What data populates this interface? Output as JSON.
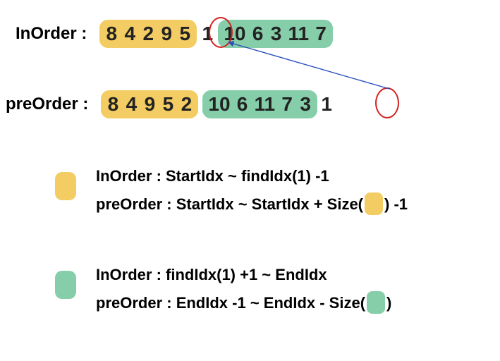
{
  "inorder": {
    "label": "InOrder :",
    "left": [
      "8",
      "4",
      "2",
      "9",
      "5"
    ],
    "root": "1",
    "right": [
      "10",
      "6",
      "3",
      "11",
      "7"
    ]
  },
  "preorder": {
    "label": "preOrder :",
    "left": [
      "8",
      "4",
      "9",
      "5",
      "2"
    ],
    "right": [
      "10",
      "6",
      "11",
      "7",
      "3"
    ],
    "root": "1"
  },
  "legend_yellow": {
    "in": "InOrder : StartIdx ~ findIdx(1) -1",
    "pre_prefix": "preOrder : StartIdx ~ StartIdx + Size(",
    "pre_suffix": ") -1"
  },
  "legend_green": {
    "in": "InOrder : findIdx(1) +1 ~ EndIdx",
    "pre_prefix": "preOrder : EndIdx -1 ~ EndIdx - Size(",
    "pre_suffix": ")"
  },
  "colors": {
    "yellow": "#f3cd63",
    "green": "#86cea9",
    "circle": "#d32222"
  }
}
